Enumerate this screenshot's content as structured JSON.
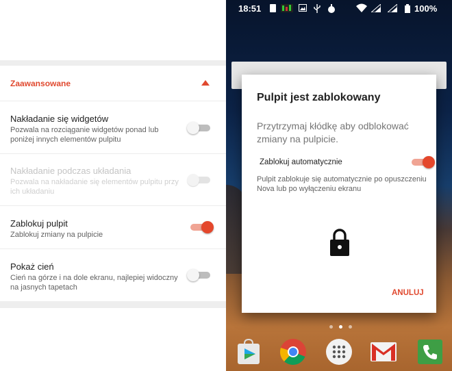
{
  "settings": {
    "section_title": "Zaawansowane",
    "items": [
      {
        "title": "Nakładanie się widgetów",
        "desc": "Pozwala na rozciąganie widgetów ponad lub poniżej innych elementów pulpitu",
        "enabled": true,
        "checked": false
      },
      {
        "title": "Nakładanie podczas układania",
        "desc": "Pozwala na nakładanie się elementów pulpitu przy ich układaniu",
        "enabled": false,
        "checked": false
      },
      {
        "title": "Zablokuj pulpit",
        "desc": "Zablokuj zmiany na pulpicie",
        "enabled": true,
        "checked": true
      },
      {
        "title": "Pokaż cień",
        "desc": "Cień na górze i na dole ekranu, najlepiej widoczny na jasnych tapetach",
        "enabled": true,
        "checked": false
      }
    ]
  },
  "status_bar": {
    "time": "18:51",
    "battery": "100%"
  },
  "dialog": {
    "title": "Pulpit jest zablokowany",
    "message": "Przytrzymaj kłódkę aby odblokować zmiany na pulpicie.",
    "toggle_label": "Zablokuj automatycznie",
    "toggle_checked": true,
    "note": "Pulpit zablokuje się automatycznie po opuszczeniu Nova lub po wyłączeniu ekranu",
    "cancel": "ANULUJ"
  },
  "colors": {
    "accent": "#e4472c",
    "accent_text": "#e0492f"
  },
  "dock": {
    "apps": [
      "play-store-icon",
      "chrome-icon",
      "app-drawer-icon",
      "gmail-icon",
      "phone-icon"
    ]
  }
}
